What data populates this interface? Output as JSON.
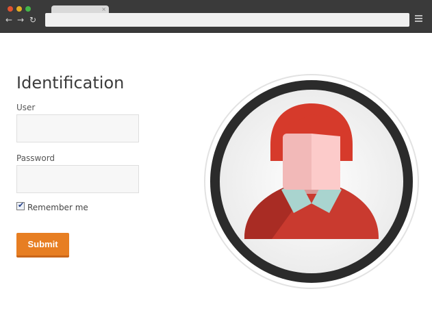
{
  "browser": {
    "tab_close_glyph": "×",
    "back_glyph": "←",
    "forward_glyph": "→",
    "reload_glyph": "↻",
    "address": ""
  },
  "form": {
    "title": "Identification",
    "user_label": "User",
    "user_value": "",
    "password_label": "Password",
    "password_value": "",
    "remember_label": "Remember me",
    "remember_checked": true,
    "submit_label": "Submit"
  },
  "colors": {
    "accent": "#e77e22",
    "avatar_ring": "#2b2b2b",
    "avatar_hair": "#d63a2b",
    "avatar_shirt": "#c93a2f",
    "avatar_collar": "#a9d4cf"
  },
  "icons": {
    "avatar": "user-avatar-icon",
    "menu": "hamburger-menu-icon"
  }
}
